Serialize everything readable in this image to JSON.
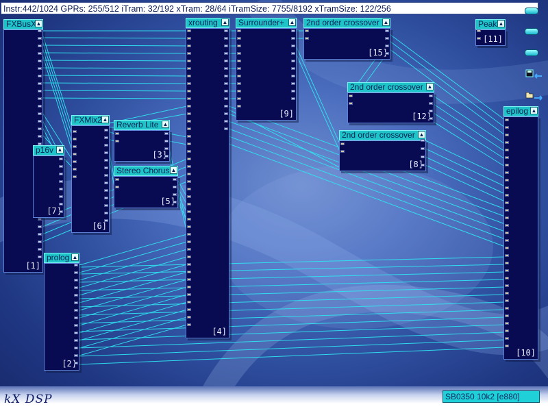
{
  "status": {
    "text": "Instr:442/1024 GPRs: 255/512 iTram: 32/192 xTram: 28/64 iTramSize: 7755/8192 xTramSize: 122/256"
  },
  "footer": {
    "brand": "kX DSP",
    "device": "SB0350 10k2 [e880]"
  },
  "modules": [
    {
      "key": "fxbusx",
      "title": "FXBusX",
      "number": "[1]"
    },
    {
      "key": "p16v",
      "title": "p16v",
      "number": "[7]"
    },
    {
      "key": "fxmix2",
      "title": "FXMix2",
      "number": "[6]"
    },
    {
      "key": "reverb",
      "title": "Reverb Lite",
      "number": "[3]"
    },
    {
      "key": "chorus",
      "title": "Stereo Chorus",
      "number": "[5]"
    },
    {
      "key": "xrouting",
      "title": "xrouting",
      "number": "[4]"
    },
    {
      "key": "surrounder",
      "title": "Surrounder+",
      "number": "[9]"
    },
    {
      "key": "cross15",
      "title": "2nd order crossover",
      "number": "[15]"
    },
    {
      "key": "cross12",
      "title": "2nd order crossover",
      "number": "[12]"
    },
    {
      "key": "cross8",
      "title": "2nd order crossover",
      "number": "[8]"
    },
    {
      "key": "peak",
      "title": "Peak",
      "number": "[11]"
    },
    {
      "key": "epilog",
      "title": "epilog",
      "number": "[10]"
    },
    {
      "key": "prolog",
      "title": "prolog",
      "number": "[2]"
    }
  ],
  "icons": {
    "collapse_glyph": "▲",
    "side_buttons": [
      "menu-icon",
      "menu-icon",
      "menu-icon"
    ],
    "save_icon": "save-icon",
    "load_icon": "load-icon"
  },
  "colors": {
    "wire": "#2fe3f0",
    "module_body": "#080a52",
    "module_header": "#1ec4c8"
  }
}
